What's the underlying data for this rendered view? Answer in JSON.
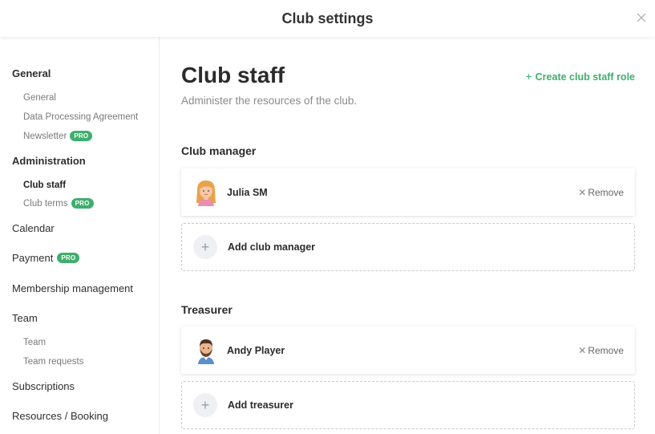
{
  "header": {
    "title": "Club settings",
    "close_icon": "close-icon"
  },
  "sidebar": {
    "general": {
      "label": "General",
      "items": [
        "General",
        "Data Processing Agreement",
        "Newsletter"
      ]
    },
    "administration": {
      "label": "Administration",
      "items": [
        "Club staff",
        "Club terms"
      ]
    },
    "calendar": "Calendar",
    "payment": "Payment",
    "membership": "Membership management",
    "team": {
      "label": "Team",
      "items": [
        "Team",
        "Team requests"
      ]
    },
    "subscriptions": "Subscriptions",
    "resources": "Resources / Booking",
    "pro_badge": "PRO",
    "active_item": "Club staff"
  },
  "main": {
    "title": "Club staff",
    "subtitle": "Administer the resources of the club.",
    "create_role": {
      "plus": "+",
      "label": "Create club staff role"
    },
    "sections": [
      {
        "title": "Club manager",
        "member": {
          "name": "Julia SM",
          "avatar": "female-avatar",
          "remove_label": "Remove"
        },
        "add_label": "Add club manager"
      },
      {
        "title": "Treasurer",
        "member": {
          "name": "Andy Player",
          "avatar": "male-avatar",
          "remove_label": "Remove"
        },
        "add_label": "Add treasurer"
      }
    ]
  },
  "colors": {
    "accent": "#3fae6d",
    "pro_badge": "#3fae6d",
    "muted_text": "#8a8a8a"
  }
}
